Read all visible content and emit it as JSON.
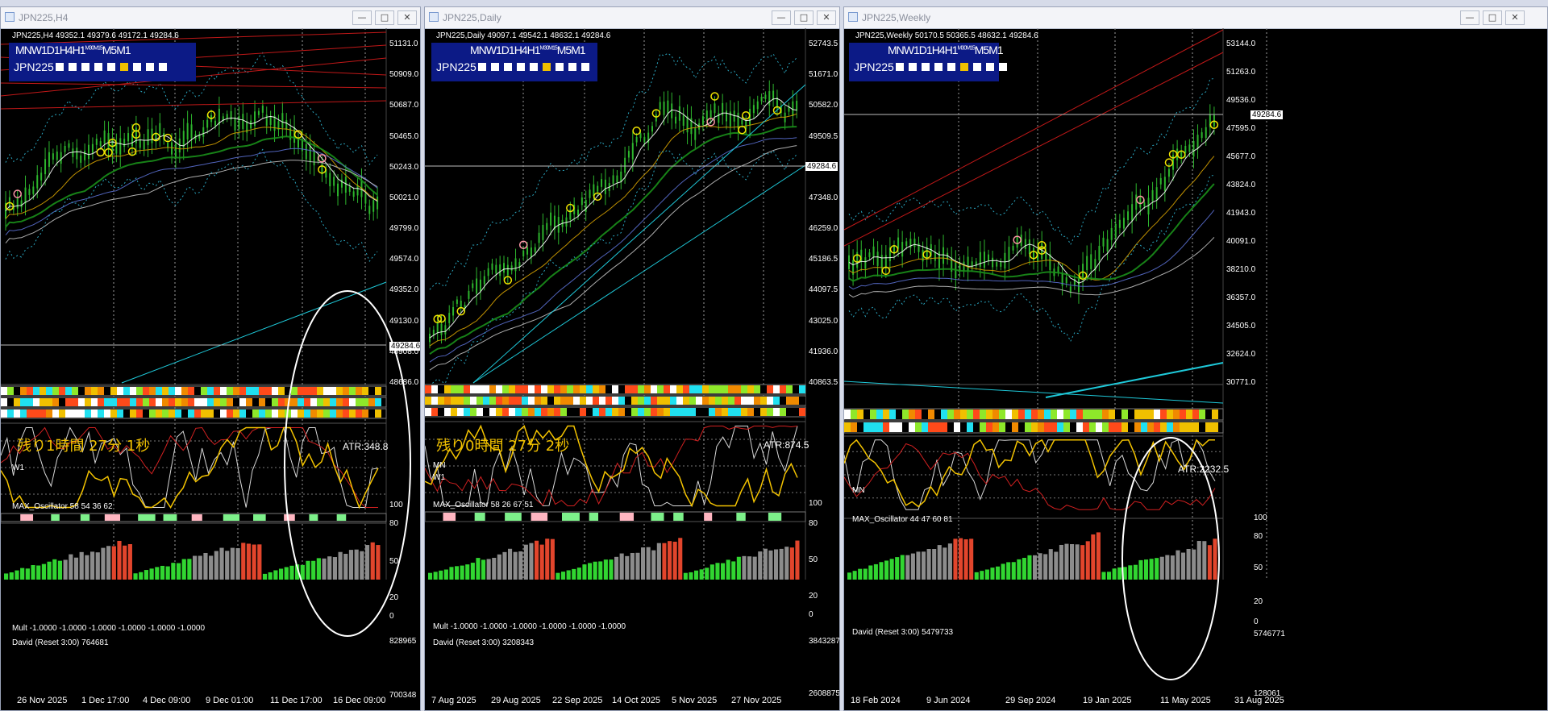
{
  "windows": [
    {
      "title": "JPN225,H4",
      "ohlc": "JPN225,H4  49352.1 49379.6 49172.1 49284.6",
      "tf_labels": [
        "MN",
        "W1",
        "D1",
        "H4",
        "H1",
        "M30",
        "M15",
        "M5",
        "M1"
      ],
      "tf_highlight": 5,
      "symbol": "JPN225",
      "countdown": "残り1時間 27分 1秒",
      "atr": "ATR:348.8",
      "price_axis": [
        "51131.0",
        "50909.0",
        "50687.0",
        "50465.0",
        "50243.0",
        "50021.0",
        "49799.0",
        "49574.0",
        "49352.0",
        "49130.0",
        "48908.0",
        "48686.0"
      ],
      "current_price": "49284.6",
      "strip_labels": [
        "W1",
        "",
        ""
      ],
      "osc_label": "MAX_Oscillator 58 54 36 62",
      "osc_axis": [
        "100",
        "80",
        "50",
        "20",
        "0"
      ],
      "mult_label": "Mult -1.0000 -1.0000 -1.0000 -1.0000 -1.0000 -1.0000",
      "david_label": "David (Reset 3:00) 764681",
      "david_axis": [
        "828965",
        "700348"
      ],
      "dates": [
        "26 Nov 2025",
        "1 Dec 17:00",
        "4 Dec 09:00",
        "9 Dec 01:00",
        "11 Dec 17:00",
        "16 Dec 09:00"
      ]
    },
    {
      "title": "JPN225,Daily",
      "ohlc": "JPN225,Daily  49097.1 49542.1 48632.1 49284.6",
      "tf_labels": [
        "MN",
        "W1",
        "D1",
        "H4",
        "H1",
        "M30",
        "M15",
        "M5",
        "M1"
      ],
      "tf_highlight": 5,
      "symbol": "JPN225",
      "countdown": "残り0時間 27分 2秒",
      "atr": "ATR:874.5",
      "price_axis": [
        "52743.5",
        "51671.0",
        "50582.0",
        "49509.5",
        "48420.5",
        "47348.0",
        "46259.0",
        "45186.5",
        "44097.5",
        "43025.0",
        "41936.0",
        "40863.5"
      ],
      "current_price": "49284.6",
      "strip_labels": [
        "MN",
        "W1",
        ""
      ],
      "osc_label": "MAX_Oscillator 58 26 67 51",
      "osc_axis": [
        "100",
        "80",
        "50",
        "20",
        "0"
      ],
      "mult_label": "Mult -1.0000 -1.0000 -1.0000 -1.0000 -1.0000 -1.0000",
      "david_label": "David (Reset 3:00) 3208343",
      "david_axis": [
        "3843287",
        "2608875"
      ],
      "dates": [
        "7 Aug 2025",
        "29 Aug 2025",
        "22 Sep 2025",
        "14 Oct 2025",
        "5 Nov 2025",
        "27 Nov 2025"
      ]
    },
    {
      "title": "JPN225,Weekly",
      "ohlc": "JPN225,Weekly  50170.5 50365.5 48632.1 49284.6",
      "tf_labels": [
        "MN",
        "W1",
        "D1",
        "H4",
        "H1",
        "M30",
        "M15",
        "M5",
        "M1"
      ],
      "tf_highlight": 5,
      "symbol": "JPN225",
      "countdown": "",
      "atr": "ATR:2232.5",
      "price_axis": [
        "53144.0",
        "51263.0",
        "49536.0",
        "47595.0",
        "45677.0",
        "43824.0",
        "41943.0",
        "40091.0",
        "38210.0",
        "36357.0",
        "34505.0",
        "32624.0",
        "30771.0"
      ],
      "current_price": "49284.6",
      "strip_labels": [
        "MN",
        ""
      ],
      "osc_label": "MAX_Oscillator 44 47 60 81",
      "osc_axis": [
        "100",
        "80",
        "50",
        "20",
        "0"
      ],
      "mult_label": "",
      "david_label": "David (Reset 3:00) 5479733",
      "david_axis": [
        "5746771",
        "128061"
      ],
      "dates": [
        "18 Feb 2024",
        "9 Jun 2024",
        "29 Sep 2024",
        "19 Jan 2025",
        "11 May 2025",
        "31 Aug 2025"
      ]
    }
  ],
  "colors": {
    "candle": "#2db52d",
    "signal": "#f2e600",
    "signal_pink": "#ff9aa8",
    "trend": "#1ec8d8",
    "panel": "#0c1a86",
    "osc_white": "#d8d8d8",
    "osc_yellow": "#f2c200",
    "osc_cyan": "#38e0f0",
    "osc_red": "#d02020",
    "vol_green": "#31d631",
    "vol_gray": "#8c8c8c",
    "vol_red": "#e2452c"
  }
}
